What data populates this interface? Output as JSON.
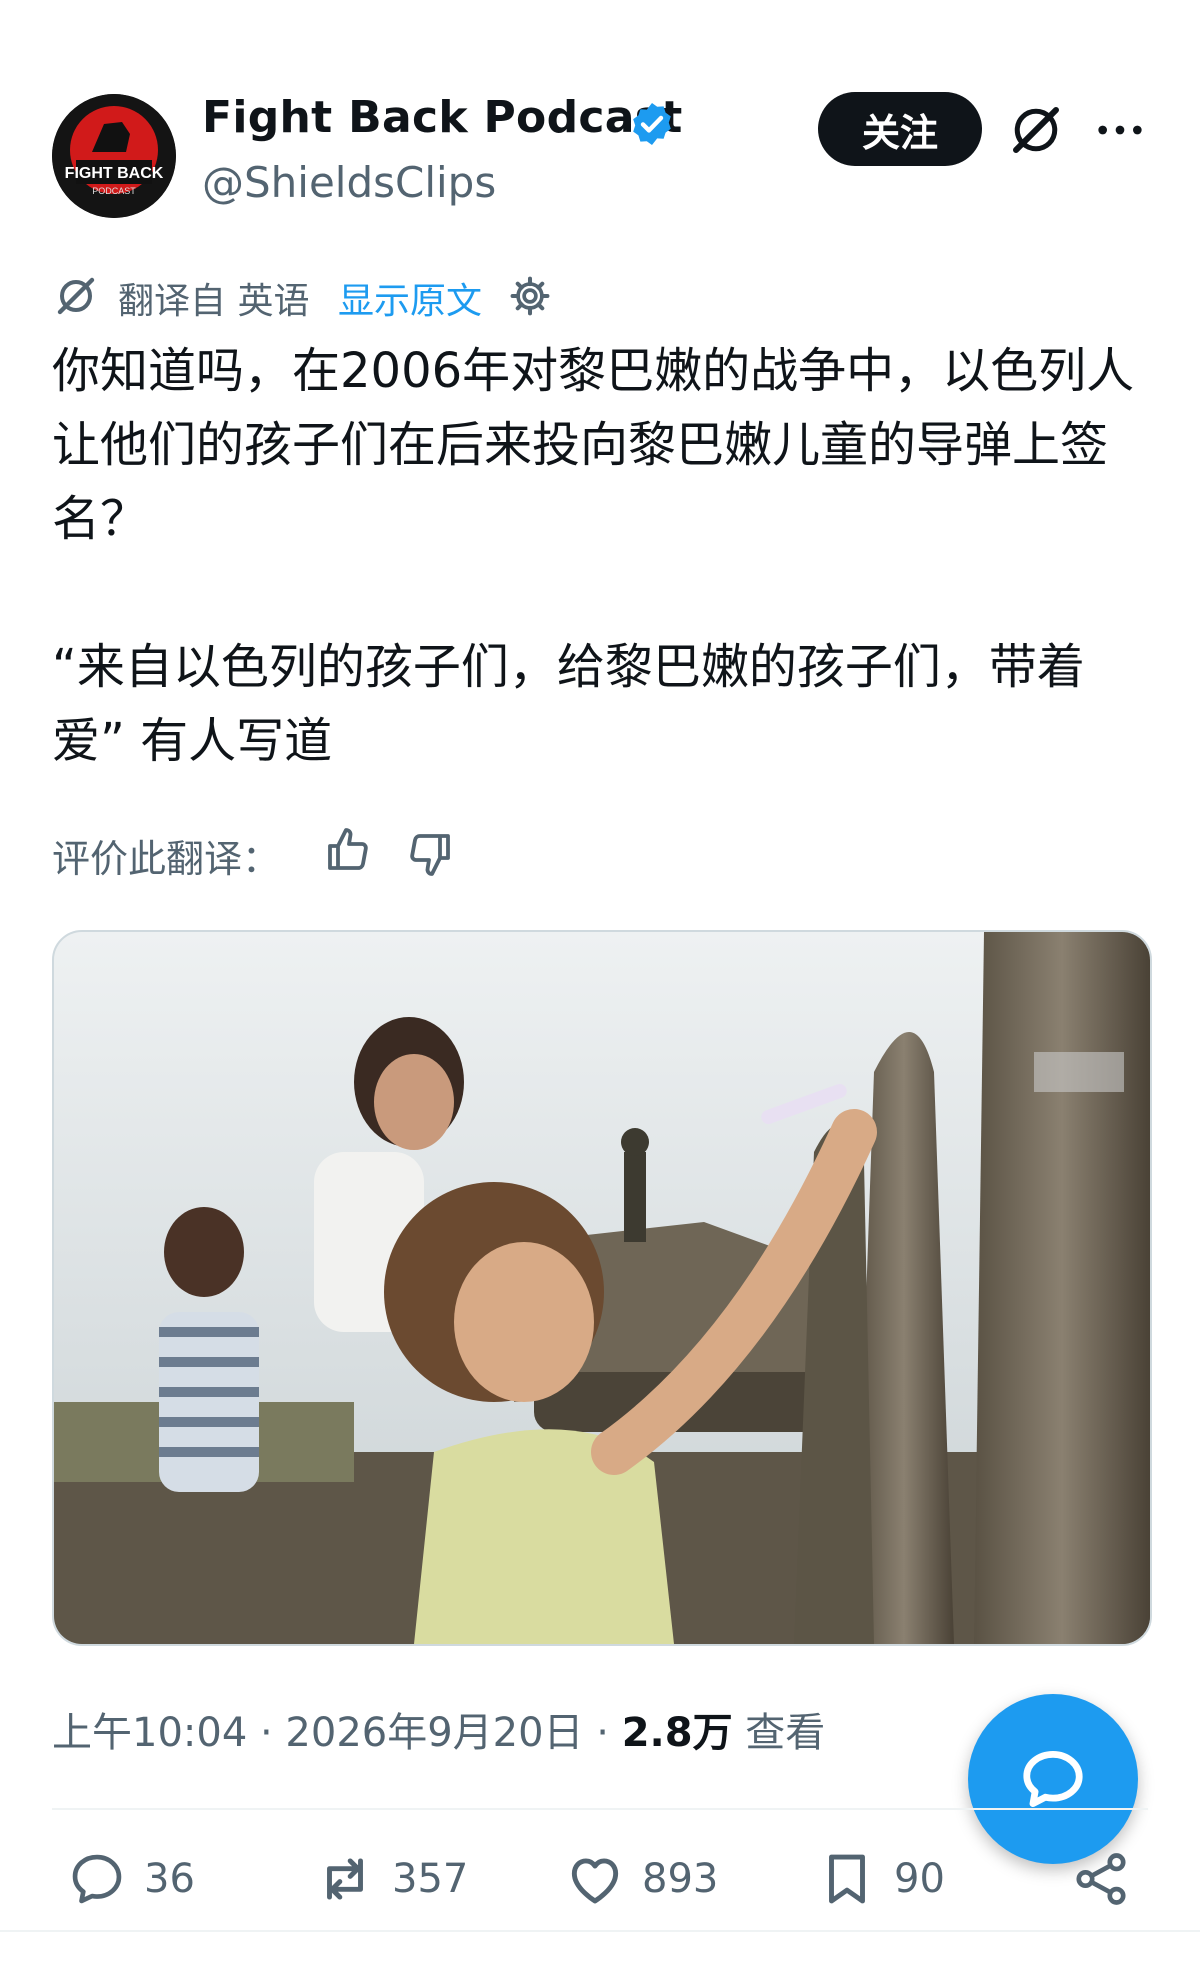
{
  "header": {
    "display_name": "Fight Back Podcast",
    "handle": "@ShieldsClips",
    "follow_label": "关注",
    "avatar_text": "FIGHT BACK",
    "avatar_subtext": "PODCAST"
  },
  "translation": {
    "from_label": "翻译自 英语",
    "show_original": "显示原文"
  },
  "tweet": {
    "text": "你知道吗，在2006年对黎巴嫩的战争中，以色列人让他们的孩子们在后来投向黎巴嫩儿童的导弹上签名？\n\n“来自以色列的孩子们，给黎巴嫩的孩子们，带着爱” 有人写道"
  },
  "rate": {
    "label": "评价此翻译："
  },
  "meta": {
    "time_date": "上午10:04 · 2026年9月20日 · ",
    "views_count": "2.8万",
    "views_label": " 查看"
  },
  "actions": {
    "replies": "36",
    "reposts": "357",
    "likes": "893",
    "bookmarks": "90"
  },
  "colors": {
    "accent": "#1d9bf0",
    "text_secondary": "#536471",
    "text_primary": "#0f1419"
  },
  "icons": [
    "verified-badge-icon",
    "grok-icon",
    "more-icon",
    "translate-icon",
    "settings-gear-icon",
    "thumbs-up-icon",
    "thumbs-down-icon",
    "reply-icon",
    "repost-icon",
    "like-icon",
    "bookmark-icon",
    "share-icon",
    "compose-message-icon"
  ]
}
